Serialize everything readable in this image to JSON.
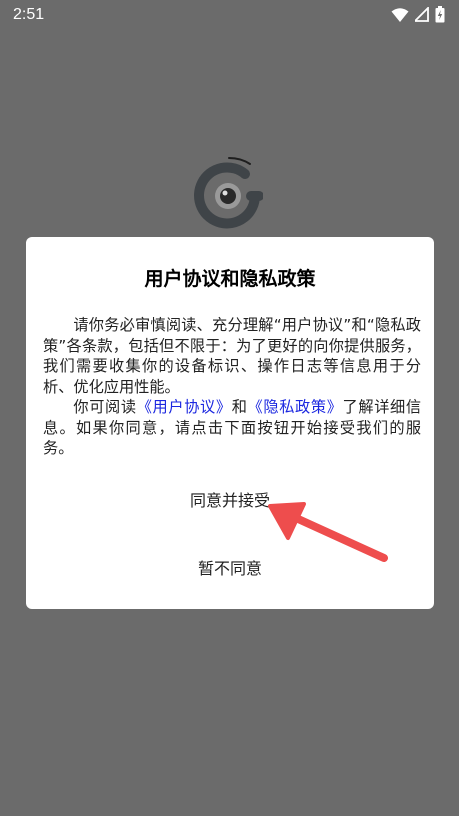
{
  "status_bar": {
    "time": "2:51",
    "icons": [
      "wifi-icon",
      "signal-icon",
      "battery-charging-icon"
    ]
  },
  "dialog": {
    "title": "用户协议和隐私政策",
    "paragraph1": "请你务必审慎阅读、充分理解“用户协议”和“隐私政策”各条款，包括但不限于：为了更好的向你提供服务，我们需要收集你的设备标识、操作日志等信息用于分析、优化应用性能。",
    "paragraph2_prefix": "你可阅读",
    "user_agreement_link": "《用户协议》",
    "paragraph2_and": "和",
    "privacy_policy_link": "《隐私政策》",
    "paragraph2_suffix": "了解详细信息。如果你同意，请点击下面按钮开始接受我们的服务。",
    "agree_label": "同意并接受",
    "decline_label": "暂不同意"
  },
  "colors": {
    "overlay": "#6b6b6b",
    "dialog_bg": "#ffffff",
    "link": "#1b27e0",
    "annotation_arrow": "#ee4d4d"
  }
}
